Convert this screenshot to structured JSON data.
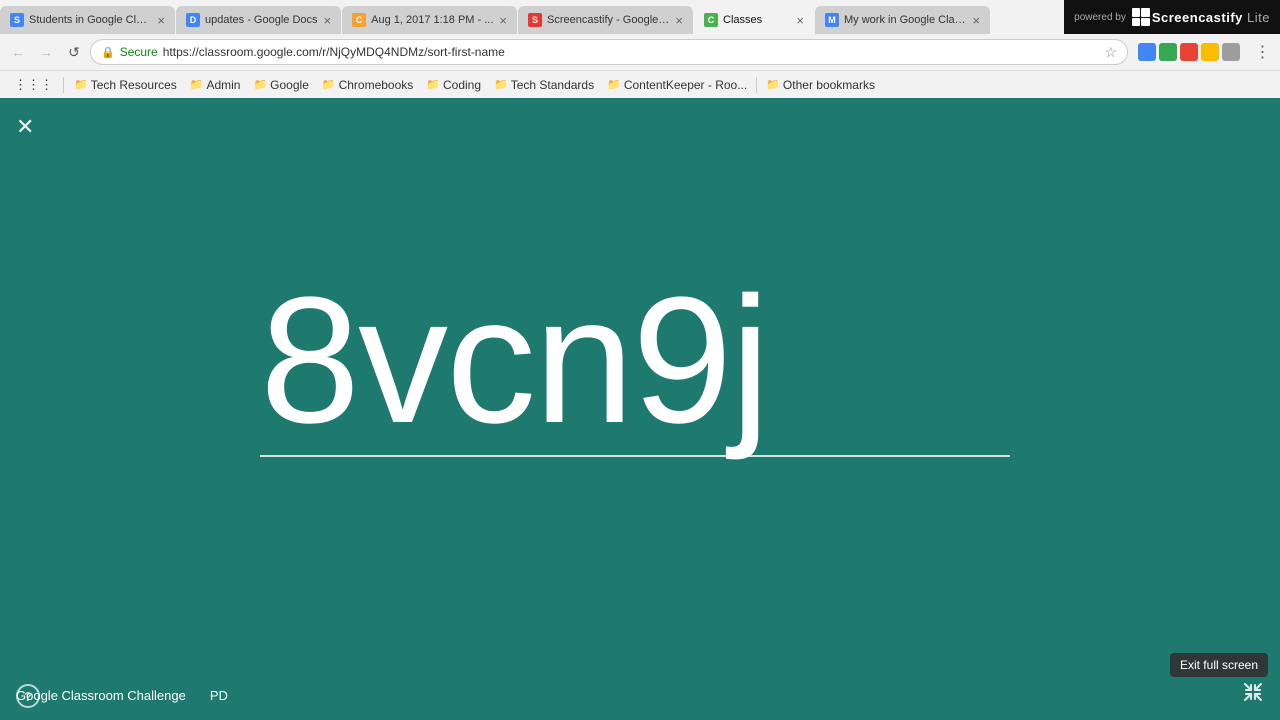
{
  "browser": {
    "tabs": [
      {
        "id": "tab1",
        "favicon_color": "#4285f4",
        "favicon_letter": "S",
        "label": "Students in Google Clas...",
        "active": false
      },
      {
        "id": "tab2",
        "favicon_color": "#4285f4",
        "favicon_letter": "D",
        "label": "updates - Google Docs",
        "active": false
      },
      {
        "id": "tab3",
        "favicon_color": "#f4a234",
        "favicon_letter": "C",
        "label": "Aug 1, 2017 1:18 PM - ...",
        "active": false
      },
      {
        "id": "tab4",
        "favicon_color": "#e53935",
        "favicon_letter": "S",
        "label": "Screencastify - Google ...",
        "active": false
      },
      {
        "id": "tab5",
        "favicon_color": "#4caf50",
        "favicon_letter": "C",
        "label": "Classes",
        "active": true
      },
      {
        "id": "tab6",
        "favicon_color": "#4285f4",
        "favicon_letter": "M",
        "label": "My work in Google Clas...",
        "active": false
      }
    ],
    "url": "https://classroom.google.com/r/NjQyMDQ4NDMz/sort-first-name",
    "secure_label": "Secure",
    "bookmarks": [
      {
        "id": "bm1",
        "label": "Tech Resources",
        "type": "folder"
      },
      {
        "id": "bm2",
        "label": "Admin",
        "type": "folder"
      },
      {
        "id": "bm3",
        "label": "Google",
        "type": "folder"
      },
      {
        "id": "bm4",
        "label": "Chromebooks",
        "type": "folder"
      },
      {
        "id": "bm5",
        "label": "Coding",
        "type": "folder"
      },
      {
        "id": "bm6",
        "label": "Tech Standards",
        "type": "folder"
      },
      {
        "id": "bm7",
        "label": "ContentKeeper - Roo...",
        "type": "folder"
      },
      {
        "id": "bm8",
        "label": "Other bookmarks",
        "type": "folder"
      }
    ],
    "screencastify": {
      "powered_by": "powered by",
      "product": "Screencastify",
      "edition": "Lite"
    }
  },
  "main": {
    "code": "8vcn9j",
    "footer_title": "Google Classroom Challenge",
    "footer_subtitle": "PD",
    "exit_fullscreen_label": "Exit full screen",
    "background_color": "#1e7a6e"
  },
  "icons": {
    "close": "✕",
    "back": "←",
    "forward": "→",
    "reload": "↺",
    "help": "?",
    "star": "☆",
    "exit_fullscreen": "⊡",
    "secure": "🔒"
  }
}
